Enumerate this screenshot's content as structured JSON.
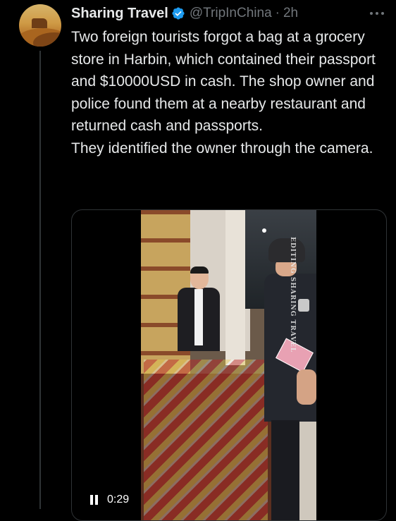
{
  "post": {
    "author_name": "Sharing Travel",
    "author_handle": "@TripInChina",
    "separator": "·",
    "time_ago": "2h",
    "paragraph_1": "Two foreign tourists forgot a bag at a grocery store in Harbin, which contained their passport and $10000USD in cash. The shop owner and police found them at a nearby restaurant and returned cash and passports.",
    "paragraph_2": "They identified the owner through the camera."
  },
  "video": {
    "duration": "0:29",
    "watermark": "EDITING SHARING TRAVEL"
  },
  "icons": {
    "verified": "verified-badge-icon",
    "more": "more-options-icon",
    "pause": "pause-icon"
  },
  "colors": {
    "background": "#000000",
    "text": "#e7e9ea",
    "secondary_text": "#71767b",
    "verified_blue": "#1d9bf0",
    "border": "#2f3336"
  }
}
